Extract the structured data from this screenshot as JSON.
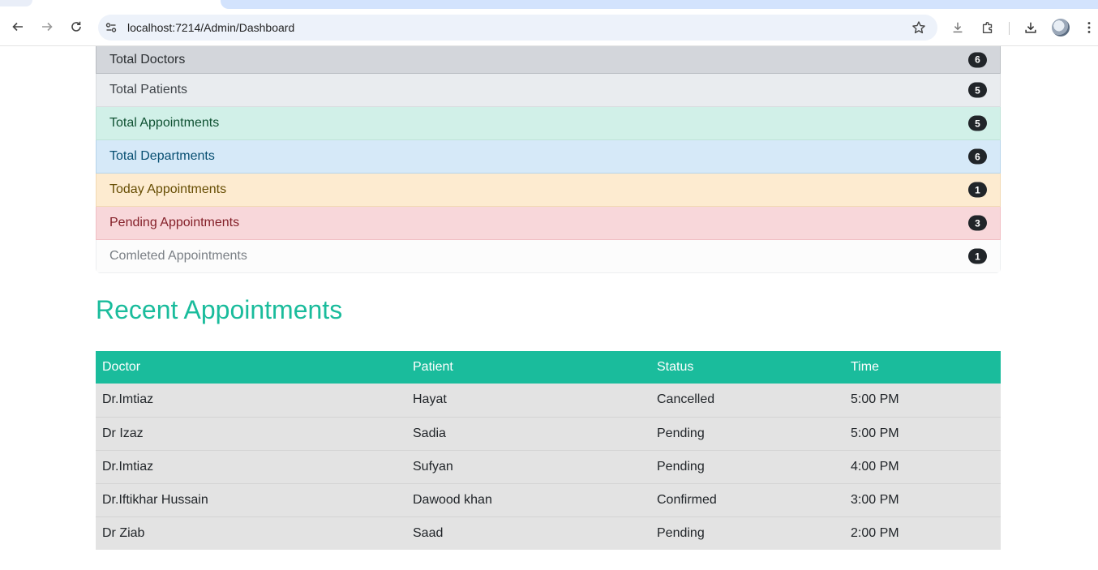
{
  "browser": {
    "url": "localhost:7214/Admin/Dashboard"
  },
  "stats": [
    {
      "label": "Total Doctors",
      "count": "6",
      "variant": "secondary"
    },
    {
      "label": "Total Patients",
      "count": "5",
      "variant": "light2"
    },
    {
      "label": "Total Appointments",
      "count": "5",
      "variant": "success"
    },
    {
      "label": "Total Departments",
      "count": "6",
      "variant": "info"
    },
    {
      "label": "Today Appointments",
      "count": "1",
      "variant": "warning"
    },
    {
      "label": "Pending Appointments",
      "count": "3",
      "variant": "danger"
    },
    {
      "label": "Comleted Appointments",
      "count": "1",
      "variant": "light"
    }
  ],
  "recent": {
    "title": "Recent Appointments",
    "columns": [
      "Doctor",
      "Patient",
      "Status",
      "Time"
    ],
    "rows": [
      {
        "doctor": "Dr.Imtiaz",
        "patient": "Hayat",
        "status": "Cancelled",
        "time": "5:00 PM"
      },
      {
        "doctor": "Dr Izaz",
        "patient": "Sadia",
        "status": "Pending",
        "time": "5:00 PM"
      },
      {
        "doctor": "Dr.Imtiaz",
        "patient": "Sufyan",
        "status": "Pending",
        "time": "4:00 PM"
      },
      {
        "doctor": "Dr.Iftikhar Hussain",
        "patient": "Dawood khan",
        "status": "Confirmed",
        "time": "3:00 PM"
      },
      {
        "doctor": "Dr Ziab",
        "patient": "Saad",
        "status": "Pending",
        "time": "2:00 PM"
      }
    ]
  },
  "colors": {
    "accent": "#1abc9c",
    "badge": "#212529"
  }
}
